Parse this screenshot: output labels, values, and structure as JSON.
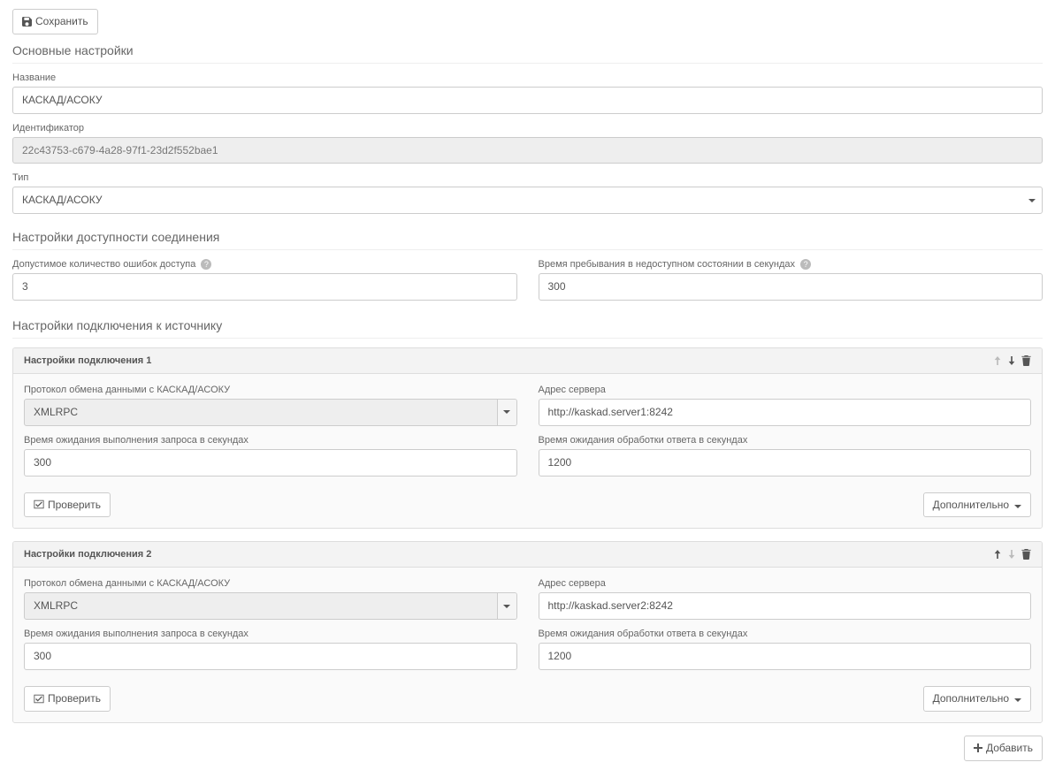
{
  "toolbar": {
    "save_label": "Сохранить"
  },
  "sections": {
    "basic": "Основные настройки",
    "availability": "Настройки доступности соединения",
    "connections": "Настройки подключения к источнику"
  },
  "basic": {
    "name_label": "Название",
    "name_value": "КАСКАД/АСОКУ",
    "id_label": "Идентификатор",
    "id_value": "22c43753-c679-4a28-97f1-23d2f552bae1",
    "type_label": "Тип",
    "type_value": "КАСКАД/АСОКУ"
  },
  "availability": {
    "errors_label": "Допустимое количество ошибок доступа",
    "errors_value": "3",
    "unavailable_label": "Время пребывания в недоступном состоянии в секундах",
    "unavailable_value": "300"
  },
  "connection_labels": {
    "protocol": "Протокол обмена данными с КАСКАД/АСОКУ",
    "server": "Адрес сервера",
    "req_timeout": "Время ожидания выполнения запроса в секундах",
    "resp_timeout": "Время ожидания обработки ответа в секундах",
    "verify": "Проверить",
    "advanced": "Дополнительно"
  },
  "connections": [
    {
      "title": "Настройки подключения 1",
      "protocol": "XMLRPC",
      "server": "http://kaskad.server1:8242",
      "req_timeout": "300",
      "resp_timeout": "1200",
      "can_up": false,
      "can_down": true
    },
    {
      "title": "Настройки подключения 2",
      "protocol": "XMLRPC",
      "server": "http://kaskad.server2:8242",
      "req_timeout": "300",
      "resp_timeout": "1200",
      "can_up": true,
      "can_down": false
    }
  ],
  "add_label": "Добавить"
}
